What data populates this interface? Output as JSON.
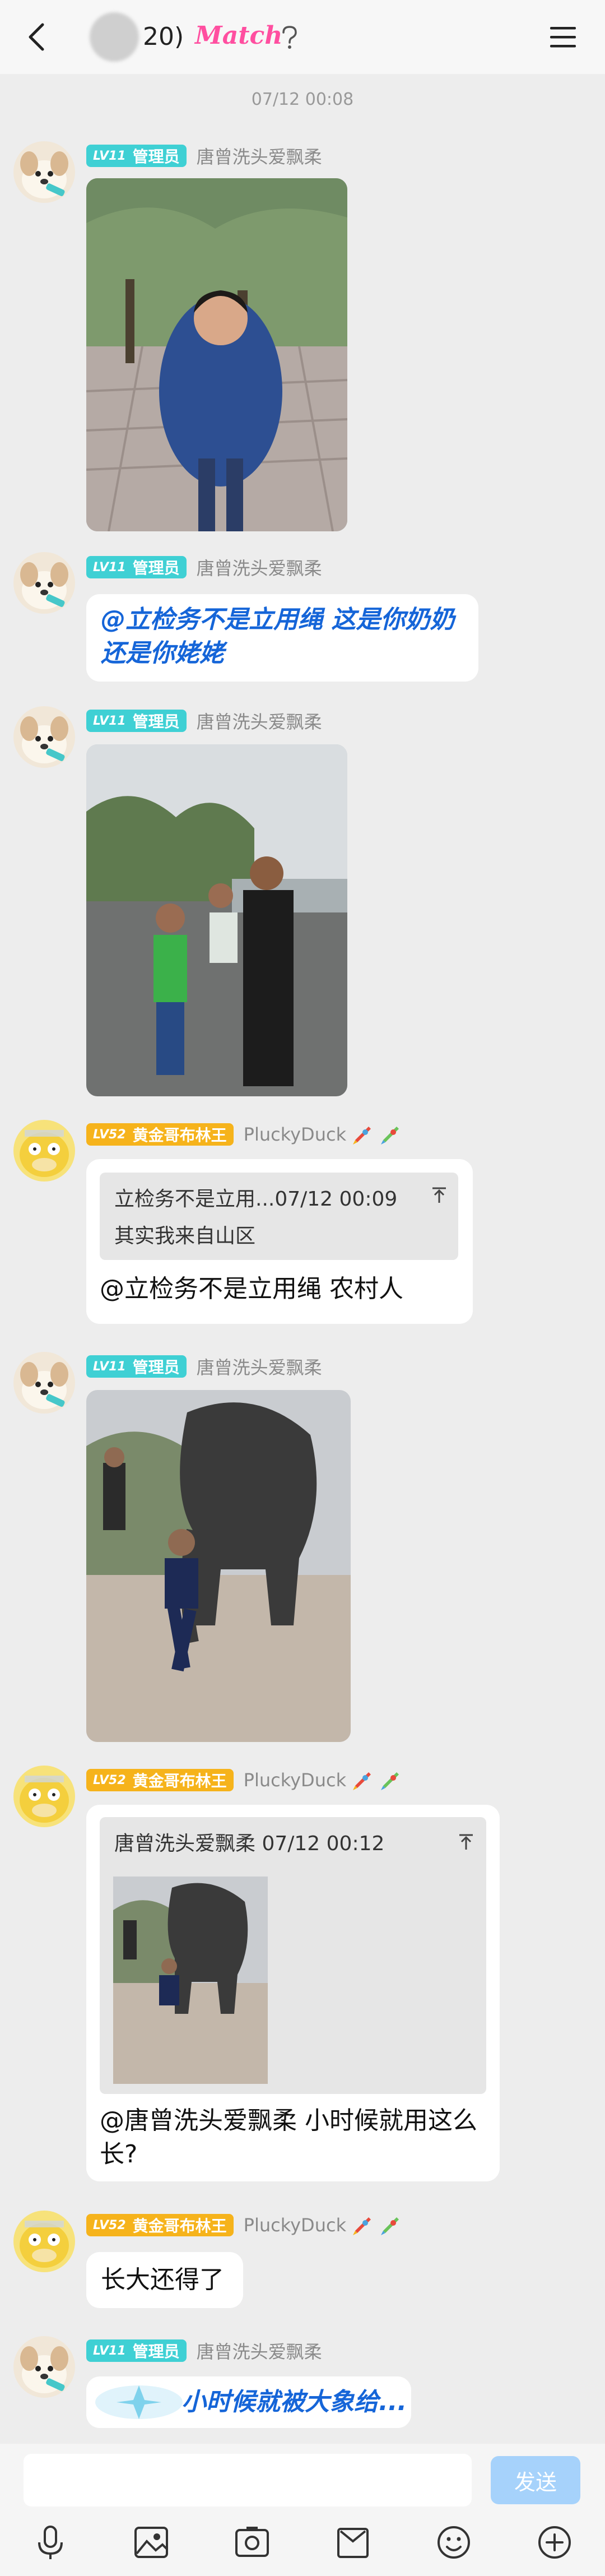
{
  "header": {
    "title_count": "20)",
    "logo_text": "Match"
  },
  "timestamp": "07/12 00:08",
  "badges": {
    "admin_level": "LV11",
    "admin_title": "管理员",
    "gold_level": "LV52",
    "gold_title": "黄金哥布林王"
  },
  "senders": {
    "admin": "唐曾洗头爱飘柔",
    "gold": "PluckyDuck"
  },
  "messages": {
    "m2_text": "@立检务不是立用绳 这是你奶奶还是你姥姥",
    "m4_quote_meta": "立检务不是立用...07/12 00:09",
    "m4_quote_text": "其实我来自山区",
    "m4_text": "@立检务不是立用绳 农村人",
    "m6_quote_meta": "唐曾洗头爱飘柔 07/12 00:12",
    "m6_text": "@唐曾洗头爱飘柔 小时候就用这么长?",
    "m7_text": "长大还得了",
    "m8_text": "小时候就被大象给..."
  },
  "input": {
    "send_label": "发送"
  },
  "colors": {
    "admin_badge": "#3fd0d4",
    "gold_badge": "#f6b31b",
    "link_text": "#1565d8",
    "send_button": "#a6d2fb",
    "logo": "#ff4fa0"
  },
  "icons": {
    "toolbar": [
      "mic-icon",
      "picture-icon",
      "photo-icon",
      "bag-icon",
      "emoji-icon",
      "plus-icon"
    ]
  }
}
